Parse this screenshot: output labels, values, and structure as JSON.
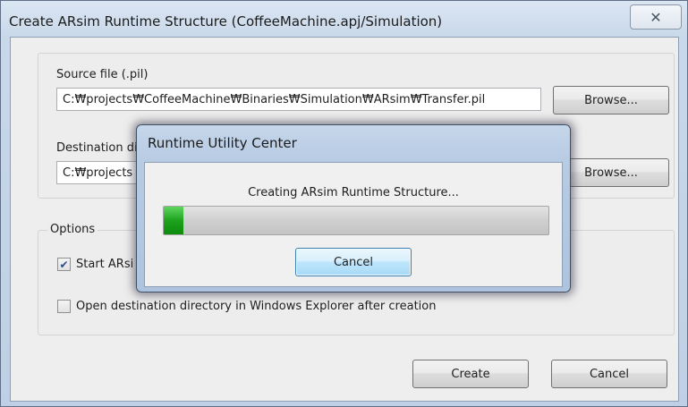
{
  "dialog": {
    "title": "Create ARsim Runtime Structure (CoffeeMachine.apj/Simulation)",
    "close_icon": "close-icon"
  },
  "source": {
    "label": "Source file (.pil)",
    "value": "C:₩projects₩CoffeeMachine₩Binaries₩Simulation₩ARsim₩Transfer.pil",
    "browse_label": "Browse..."
  },
  "destination": {
    "label": "Destination di",
    "value": "C:₩projects",
    "browse_label": "Browse..."
  },
  "options": {
    "label": "Options",
    "start_label": "Start ARsi",
    "start_checked": true,
    "open_label": "Open destination directory in Windows Explorer after creation",
    "open_checked": false
  },
  "footer": {
    "create_label": "Create",
    "cancel_label": "Cancel"
  },
  "progress_dialog": {
    "title": "Runtime Utility Center",
    "message": "Creating ARsim Runtime Structure...",
    "progress_fraction": 0.05,
    "cancel_label": "Cancel"
  },
  "colors": {
    "progress_green": "#1ea31e",
    "accent_blue": "#3c7fb1"
  }
}
